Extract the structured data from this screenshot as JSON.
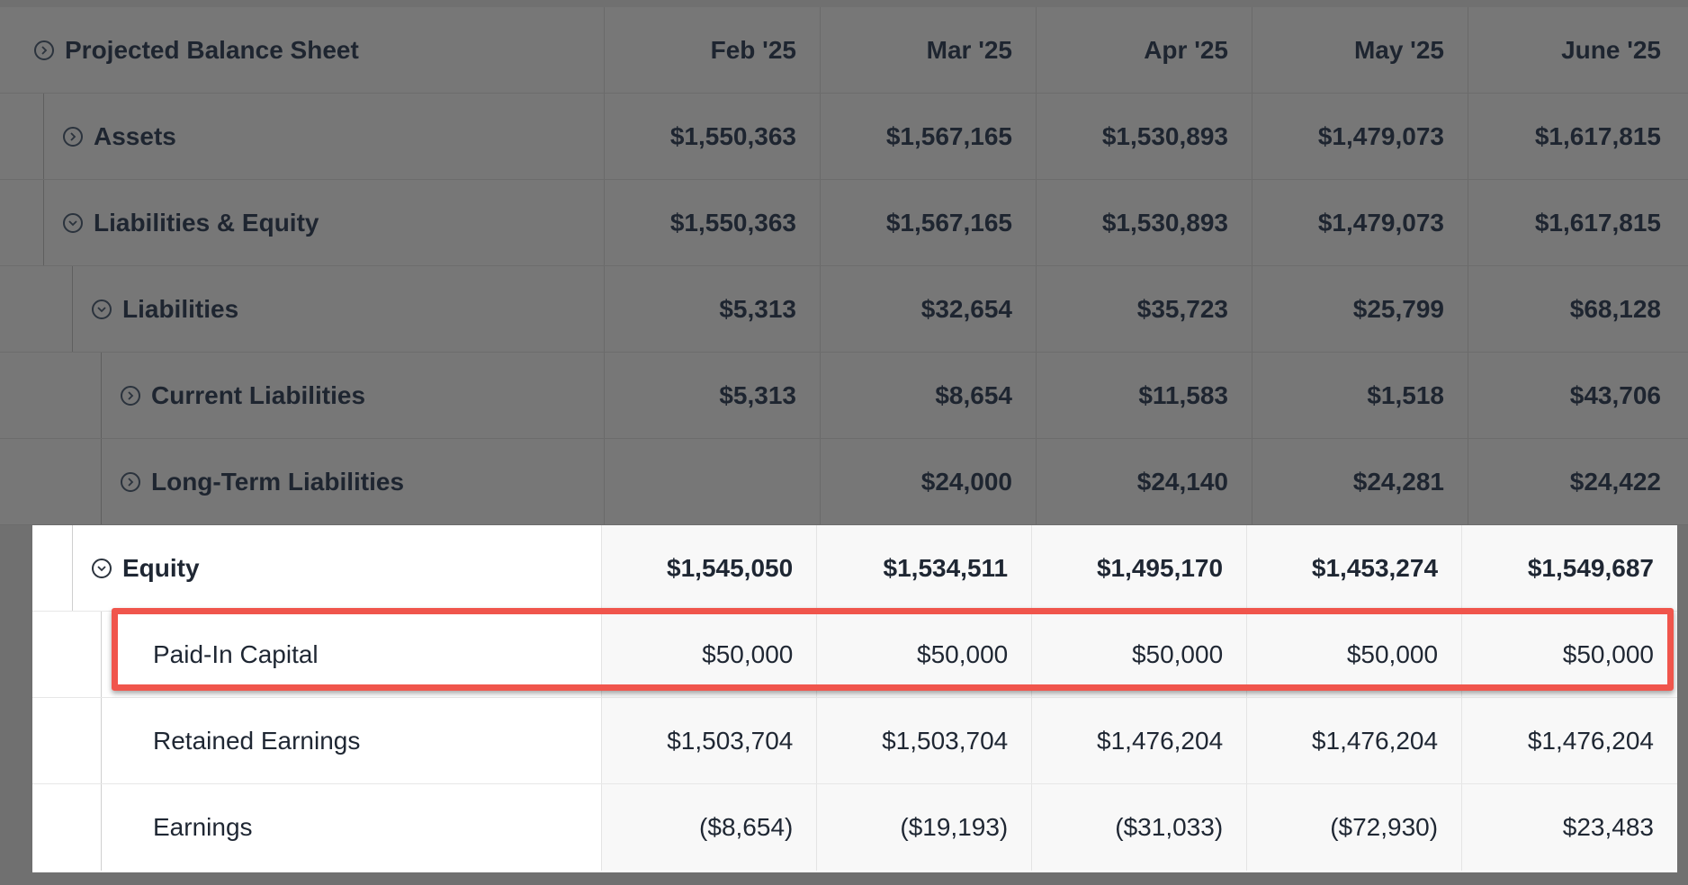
{
  "header": {
    "title": "Projected Balance Sheet",
    "months": [
      "Feb '25",
      "Mar '25",
      "Apr '25",
      "May '25",
      "June '25"
    ]
  },
  "rows": {
    "assets": {
      "label": "Assets",
      "values": [
        "$1,550,363",
        "$1,567,165",
        "$1,530,893",
        "$1,479,073",
        "$1,617,815"
      ]
    },
    "liab_equity": {
      "label": "Liabilities & Equity",
      "values": [
        "$1,550,363",
        "$1,567,165",
        "$1,530,893",
        "$1,479,073",
        "$1,617,815"
      ]
    },
    "liabilities": {
      "label": "Liabilities",
      "values": [
        "$5,313",
        "$32,654",
        "$35,723",
        "$25,799",
        "$68,128"
      ]
    },
    "current_liabilities": {
      "label": "Current Liabilities",
      "values": [
        "$5,313",
        "$8,654",
        "$11,583",
        "$1,518",
        "$43,706"
      ]
    },
    "long_term_liabilities": {
      "label": "Long-Term Liabilities",
      "values": [
        "",
        "$24,000",
        "$24,140",
        "$24,281",
        "$24,422"
      ]
    },
    "equity": {
      "label": "Equity",
      "values": [
        "$1,545,050",
        "$1,534,511",
        "$1,495,170",
        "$1,453,274",
        "$1,549,687"
      ]
    },
    "paid_in_capital": {
      "label": "Paid-In Capital",
      "values": [
        "$50,000",
        "$50,000",
        "$50,000",
        "$50,000",
        "$50,000"
      ]
    },
    "retained_earnings": {
      "label": "Retained Earnings",
      "values": [
        "$1,503,704",
        "$1,503,704",
        "$1,476,204",
        "$1,476,204",
        "$1,476,204"
      ]
    },
    "earnings": {
      "label": "Earnings",
      "values": [
        "($8,654)",
        "($19,193)",
        "($31,033)",
        "($72,930)",
        "$23,483"
      ]
    }
  },
  "icons": {
    "collapsed": "chevron-right-circle-icon",
    "expanded": "chevron-down-circle-icon"
  },
  "colors": {
    "overlay": "#777777",
    "highlight": "#f0554c",
    "text": "#1f2733"
  }
}
